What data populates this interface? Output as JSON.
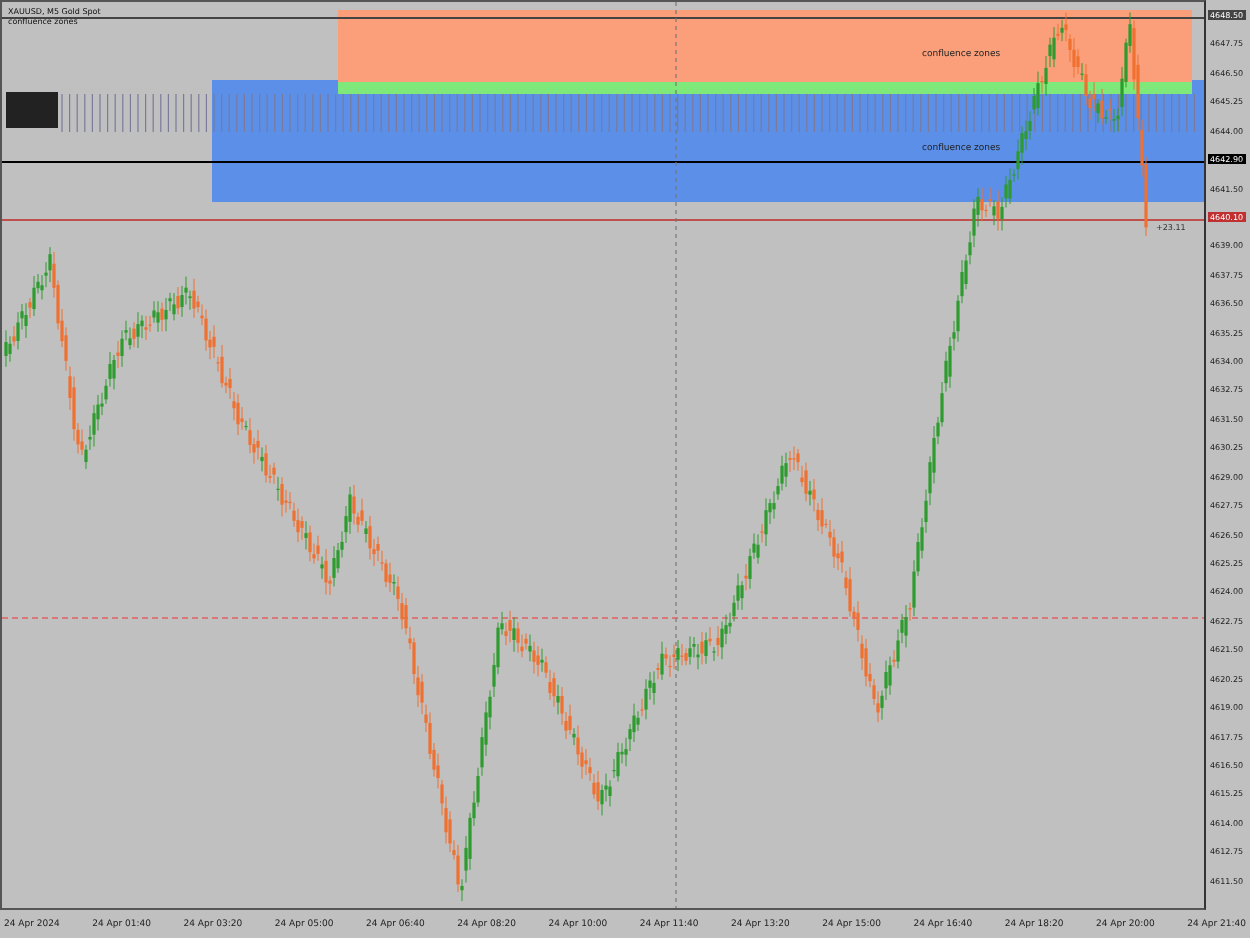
{
  "header": {
    "title": "XAUUSD, M5  Gold Spot",
    "subtitle": "confluence zones"
  },
  "zones": [
    {
      "kind": "orange",
      "label": "confluence zones"
    },
    {
      "kind": "green"
    },
    {
      "kind": "blue",
      "label": "confluence zones"
    }
  ],
  "marker_label": "+23.11",
  "price_axis": [
    {
      "kind": "tag",
      "text": "4648.50",
      "color": "#444444"
    },
    {
      "kind": "label",
      "text": "4647.75"
    },
    {
      "kind": "label",
      "text": "4646.50"
    },
    {
      "kind": "label",
      "text": "4645.25"
    },
    {
      "kind": "label",
      "text": "4644.00"
    },
    {
      "kind": "tag",
      "text": "4642.90",
      "color": "#000000"
    },
    {
      "kind": "label",
      "text": "4641.50"
    },
    {
      "kind": "tag",
      "text": "4640.10",
      "color": "#c03030"
    },
    {
      "kind": "label",
      "text": "4639.00"
    },
    {
      "kind": "label",
      "text": "4637.75"
    },
    {
      "kind": "label",
      "text": "4636.50"
    },
    {
      "kind": "label",
      "text": "4635.25"
    },
    {
      "kind": "label",
      "text": "4634.00"
    },
    {
      "kind": "label",
      "text": "4632.75"
    },
    {
      "kind": "label",
      "text": "4631.50"
    },
    {
      "kind": "label",
      "text": "4630.25"
    },
    {
      "kind": "label",
      "text": "4629.00"
    },
    {
      "kind": "label",
      "text": "4627.75"
    },
    {
      "kind": "label",
      "text": "4626.50"
    },
    {
      "kind": "label",
      "text": "4625.25"
    },
    {
      "kind": "label",
      "text": "4624.00"
    },
    {
      "kind": "label",
      "text": "4622.75"
    },
    {
      "kind": "label",
      "text": "4621.50"
    },
    {
      "kind": "label",
      "text": "4620.25"
    },
    {
      "kind": "label",
      "text": "4619.00"
    },
    {
      "kind": "label",
      "text": "4617.75"
    },
    {
      "kind": "label",
      "text": "4616.50"
    },
    {
      "kind": "label",
      "text": "4615.25"
    },
    {
      "kind": "label",
      "text": "4614.00"
    },
    {
      "kind": "label",
      "text": "4612.75"
    },
    {
      "kind": "label",
      "text": "4611.50"
    }
  ],
  "time_axis": [
    "24 Apr 2024",
    "24 Apr 01:40",
    "24 Apr 03:20",
    "24 Apr 05:00",
    "24 Apr 06:40",
    "24 Apr 08:20",
    "24 Apr 10:00",
    "24 Apr 11:40",
    "24 Apr 13:20",
    "24 Apr 15:00",
    "24 Apr 16:40",
    "24 Apr 18:20",
    "24 Apr 20:00",
    "24 Apr 21:40"
  ]
}
